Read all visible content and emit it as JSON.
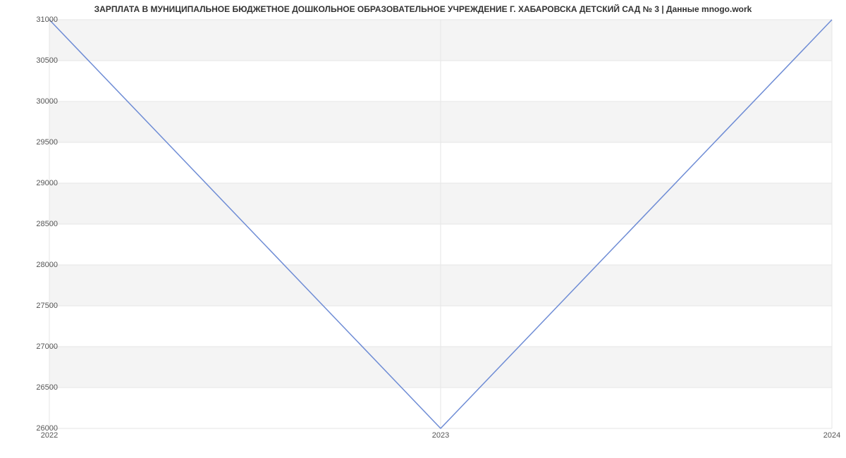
{
  "chart_data": {
    "type": "line",
    "title": "ЗАРПЛАТА В МУНИЦИПАЛЬНОЕ БЮДЖЕТНОЕ ДОШКОЛЬНОЕ ОБРАЗОВАТЕЛЬНОЕ УЧРЕЖДЕНИЕ Г. ХАБАРОВСКА ДЕТСКИЙ САД № 3 | Данные mnogo.work",
    "x": [
      "2022",
      "2023",
      "2024"
    ],
    "values": [
      31000,
      26000,
      31000
    ],
    "xlabel": "",
    "ylabel": "",
    "ylim": [
      26000,
      31000
    ],
    "y_ticks": [
      26000,
      26500,
      27000,
      27500,
      28000,
      28500,
      29000,
      29500,
      30000,
      30500,
      31000
    ],
    "x_ticks": [
      "2022",
      "2023",
      "2024"
    ],
    "grid": true,
    "line_color": "#6E8CD5"
  }
}
